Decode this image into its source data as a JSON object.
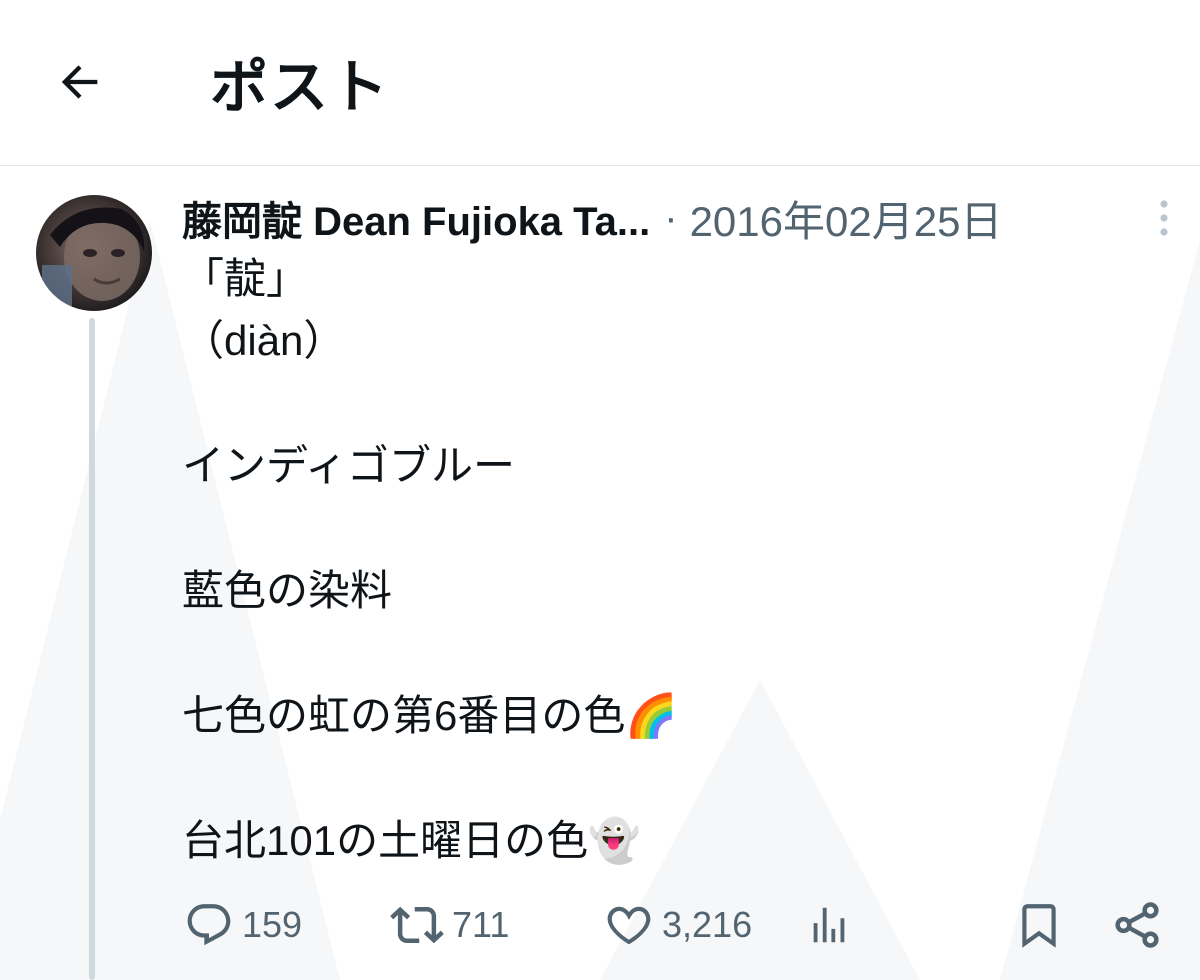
{
  "header": {
    "title": "ポスト",
    "back_icon": "arrow-left-icon"
  },
  "post": {
    "author_display": "藤岡靛 Dean Fujioka Ta...",
    "separator": "·",
    "date": "2016年02月25日",
    "more_icon": "more-vertical-icon",
    "avatar_icon": "avatar-photo",
    "text_lines": [
      "「靛」",
      "（diàn）",
      "",
      "インディゴブルー",
      "",
      "藍色の染料",
      "",
      "七色の虹の第6番目の色🌈",
      "",
      "台北101の土曜日の色👻"
    ]
  },
  "actions": {
    "reply": {
      "icon": "reply-icon",
      "count": "159"
    },
    "repost": {
      "icon": "repost-icon",
      "count": "711"
    },
    "like": {
      "icon": "heart-icon",
      "count": "3,216"
    },
    "views": {
      "icon": "views-chart-icon"
    },
    "bookmark": {
      "icon": "bookmark-icon"
    },
    "share": {
      "icon": "share-icon"
    }
  },
  "colors": {
    "text_primary": "#0f1419",
    "text_secondary": "#536471",
    "divider": "#e4e6e8",
    "thread_line": "#cfd9de"
  }
}
